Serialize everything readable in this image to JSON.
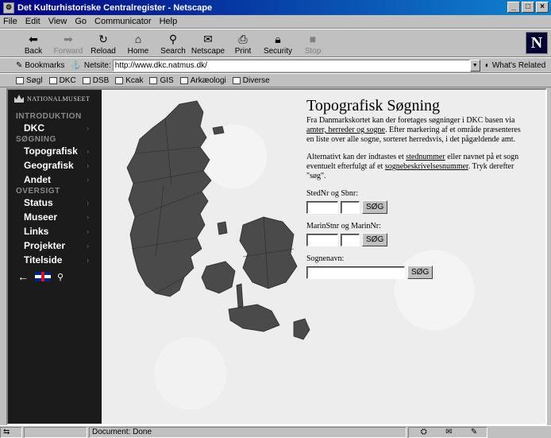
{
  "window": {
    "title": "Det Kulturhistoriske Centralregister - Netscape"
  },
  "menu": [
    "File",
    "Edit",
    "View",
    "Go",
    "Communicator",
    "Help"
  ],
  "toolbar": {
    "buttons": [
      {
        "label": "Back",
        "icon": "back-arrow-icon"
      },
      {
        "label": "Forward",
        "icon": "forward-arrow-icon"
      },
      {
        "label": "Reload",
        "icon": "reload-icon"
      },
      {
        "label": "Home",
        "icon": "home-icon"
      },
      {
        "label": "Search",
        "icon": "search-icon"
      },
      {
        "label": "Netscape",
        "icon": "netscape-icon"
      },
      {
        "label": "Print",
        "icon": "print-icon"
      },
      {
        "label": "Security",
        "icon": "security-lock-icon"
      },
      {
        "label": "Stop",
        "icon": "stop-icon"
      }
    ],
    "logo": "N"
  },
  "location": {
    "bookmarks_label": "Bookmarks",
    "netsite_label": "Netsite:",
    "url": "http://www.dkc.natmus.dk/",
    "related_label": "What's Related"
  },
  "personal_toolbar": [
    "Søgl",
    "DKC",
    "DSB",
    "Kcak",
    "GIS",
    "Arkæologi",
    "Diverse"
  ],
  "sidebar": {
    "brand": "NATIONALMUSEET",
    "sections": [
      {
        "heading": "INTRODUKTION",
        "items": [
          "DKC"
        ]
      },
      {
        "heading": "SØGNING",
        "items": [
          "Topografisk",
          "Geografisk",
          "Andet"
        ]
      },
      {
        "heading": "OVERSIGT",
        "items": [
          "Status",
          "Museer",
          "Links",
          "Projekter",
          "Titelside"
        ]
      }
    ]
  },
  "main": {
    "title": "Topografisk Søgning",
    "para1_a": "Fra Danmarkskortet kan der foretages søgninger i DKC basen via ",
    "link_amter": "amter, herreder og sogne",
    "para1_b": ". Efter markering af et område præsenteres en liste over alle sogne, sorteret herredsvis, i det pågældende amt.",
    "para2_a": "Alternativt kan der indtastes et ",
    "link_stednummer": "stednummer",
    "para2_b": " eller navnet på et sogn eventuelt efterfulgt af et ",
    "link_sognebeskrivelse": "sognebeskrivelsesnummer",
    "para2_c": ". Tryk derefter \"søg\".",
    "form1_label": "StedNr og Sbnr:",
    "form2_label": "MarinStnr og MarinNr:",
    "form3_label": "Sognenavn:",
    "search_button": "SØG"
  },
  "status": {
    "text": "Document: Done"
  }
}
